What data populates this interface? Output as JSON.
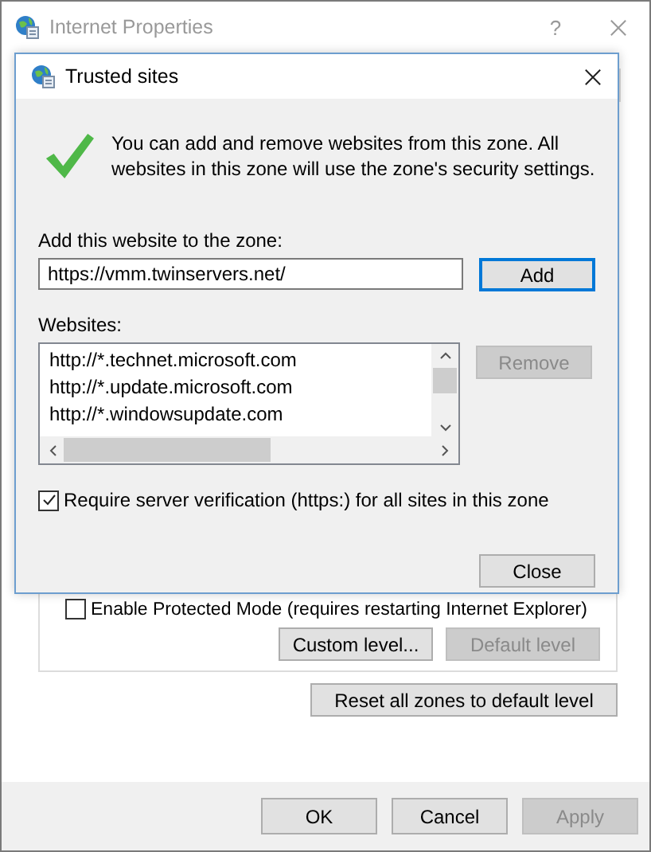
{
  "window": {
    "title": "Internet Properties",
    "help": "?"
  },
  "dialog": {
    "title": "Trusted sites",
    "message": "You can add and remove websites from this zone. All websites in this zone will use the zone's security settings.",
    "add_label": "Add this website to the zone:",
    "add_field": {
      "value": "https://vmm.twinservers.net/"
    },
    "add_button": {
      "label": "Add",
      "disabled": false,
      "default": true
    },
    "websites_label": "Websites:",
    "websites": [
      "http://*.technet.microsoft.com",
      "http://*.update.microsoft.com",
      "http://*.windowsupdate.com"
    ],
    "remove_button": {
      "label": "Remove",
      "disabled": true,
      "default": false
    },
    "require_https": {
      "label": "Require server verification (https:) for all sites in this zone",
      "checked": true
    },
    "close_button": {
      "label": "Close",
      "disabled": false,
      "default": false
    }
  },
  "protected_mode": {
    "label": "Enable Protected Mode (requires restarting Internet Explorer)",
    "checked": false
  },
  "level_buttons": [
    {
      "label": "Custom level...",
      "disabled": false
    },
    {
      "label": "Default level",
      "disabled": true
    }
  ],
  "reset_button": {
    "label": "Reset all zones to default level",
    "disabled": false
  },
  "footer_buttons": [
    {
      "label": "OK",
      "disabled": false
    },
    {
      "label": "Cancel",
      "disabled": false
    },
    {
      "label": "Apply",
      "disabled": true
    }
  ]
}
